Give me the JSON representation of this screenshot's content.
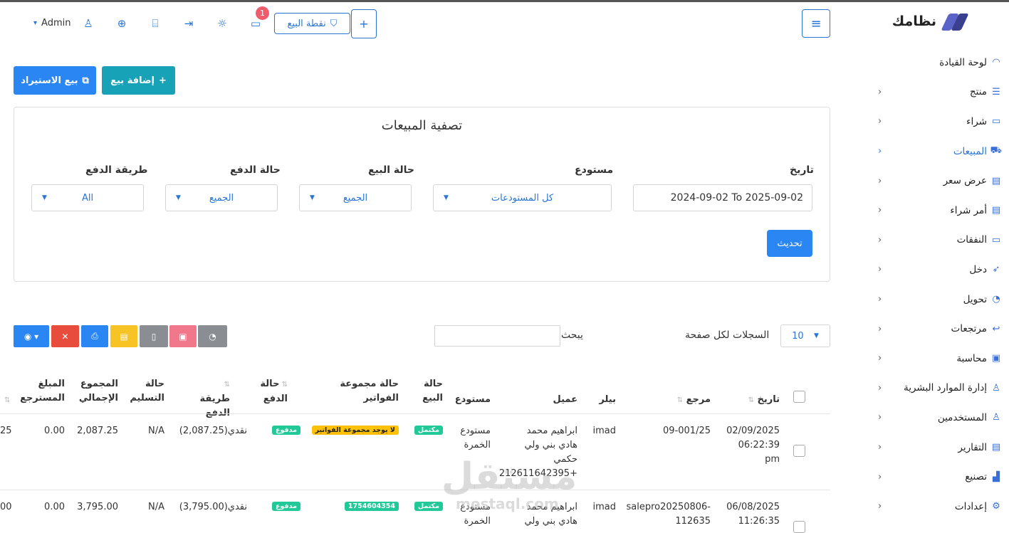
{
  "brand": {
    "name": "نظامك"
  },
  "header": {
    "menu_icon": "hamburger-icon",
    "add_icon": "plus-icon",
    "pos_label": "نقطة البيع",
    "notif_count": "1",
    "admin_label": "Admin"
  },
  "sidebar": {
    "items": [
      {
        "label": "لوحة القيادة",
        "icon": "dashboard-icon",
        "has_chev": false
      },
      {
        "label": "منتج",
        "icon": "list-icon",
        "has_chev": true
      },
      {
        "label": "شراء",
        "icon": "card-icon",
        "has_chev": true
      },
      {
        "label": "المبيعات",
        "icon": "cart-icon",
        "has_chev": true,
        "active": true
      },
      {
        "label": "عرض سعر",
        "icon": "doc-icon",
        "has_chev": true
      },
      {
        "label": "أمر شراء",
        "icon": "doc-icon",
        "has_chev": true
      },
      {
        "label": "النفقات",
        "icon": "wallet-icon",
        "has_chev": true
      },
      {
        "label": "دخل",
        "icon": "rocket-icon",
        "has_chev": true
      },
      {
        "label": "تحويل",
        "icon": "rss-icon",
        "has_chev": true
      },
      {
        "label": "مرتجعات",
        "icon": "return-icon",
        "has_chev": true
      },
      {
        "label": "محاسبة",
        "icon": "briefcase-icon",
        "has_chev": true
      },
      {
        "label": "إدارة الموارد البشرية",
        "icon": "users-icon",
        "has_chev": true
      },
      {
        "label": "المستخدمين",
        "icon": "user-icon",
        "has_chev": true
      },
      {
        "label": "التقارير",
        "icon": "report-icon",
        "has_chev": true
      },
      {
        "label": "تصنيع",
        "icon": "factory-icon",
        "has_chev": true
      },
      {
        "label": "إعدادات",
        "icon": "gear-icon",
        "has_chev": true
      }
    ]
  },
  "actions": {
    "add_sale": "إضافة بيع",
    "import_sale": "بيع الاستيراد"
  },
  "filter": {
    "title": "تصفية المبيعات",
    "date_label": "تاريخ",
    "date_value": "2024-09-02 To 2025-09-02",
    "warehouse_label": "مستودع",
    "warehouse_value": "كل المستودعات",
    "sale_status_label": "حالة البيع",
    "sale_status_value": "الجميع",
    "payment_status_label": "حالة الدفع",
    "payment_status_value": "الجميع",
    "payment_method_label": "طريقة الدفع",
    "payment_method_value": "All",
    "update_label": "تحديث"
  },
  "table_controls": {
    "per_page_label": "السجلات لكل صفحة",
    "per_page_value": "10",
    "search_label": "يبحث"
  },
  "table": {
    "headers": {
      "date": "تاريخ",
      "reference": "مرجع",
      "biller": "بيلر",
      "customer": "عميل",
      "warehouse": "مستودع",
      "sale_status": "حالة البيع",
      "invoice_group_status": "حالة مجموعة الفواتير",
      "payment_status": "حالة الدفع",
      "payment_method": "طريقة الدفع",
      "delivery_status": "حالة التسليم",
      "grand_total": "المجموع الإجمالي",
      "returned_amount": "المبلغ المسترجع"
    },
    "rows": [
      {
        "date": "02/09/2025 06:22:39 pm",
        "reference": "09-001/25",
        "biller": "imad",
        "customer": "ابراهيم محمد هادي بني ولي حكمي +212611642395",
        "warehouse": "مستودع الخمرة",
        "sale_status": "مكتمل",
        "invoice_group_status": "لا يوجد مجموعة الفواتير",
        "payment_status": "مدفوع",
        "payment_method": "نقدي(2,087.25)",
        "delivery_status": "N/A",
        "grand_total": "2,087.25",
        "returned_amount": "0.00",
        "cut": "25"
      },
      {
        "date": "06/08/2025 11:26:35",
        "reference": "salepro20250806-112635",
        "biller": "imad",
        "customer": "ابراهيم محمد هادي بني ولي",
        "warehouse": "مستودع الخمرة",
        "sale_status": "مكتمل",
        "invoice_group_status": "1754604354",
        "payment_status": "مدفوع",
        "payment_method": "نقدي(3,795.00)",
        "delivery_status": "N/A",
        "grand_total": "3,795.00",
        "returned_amount": "0.00",
        "cut": "00"
      }
    ]
  },
  "watermark": {
    "main": "مستقل",
    "sub": "mostaql.com"
  },
  "colors": {
    "primary": "#2a74d6",
    "teal": "#17a2b8",
    "danger": "#e74c3c",
    "success": "#20c997",
    "warning": "#ffc107"
  }
}
